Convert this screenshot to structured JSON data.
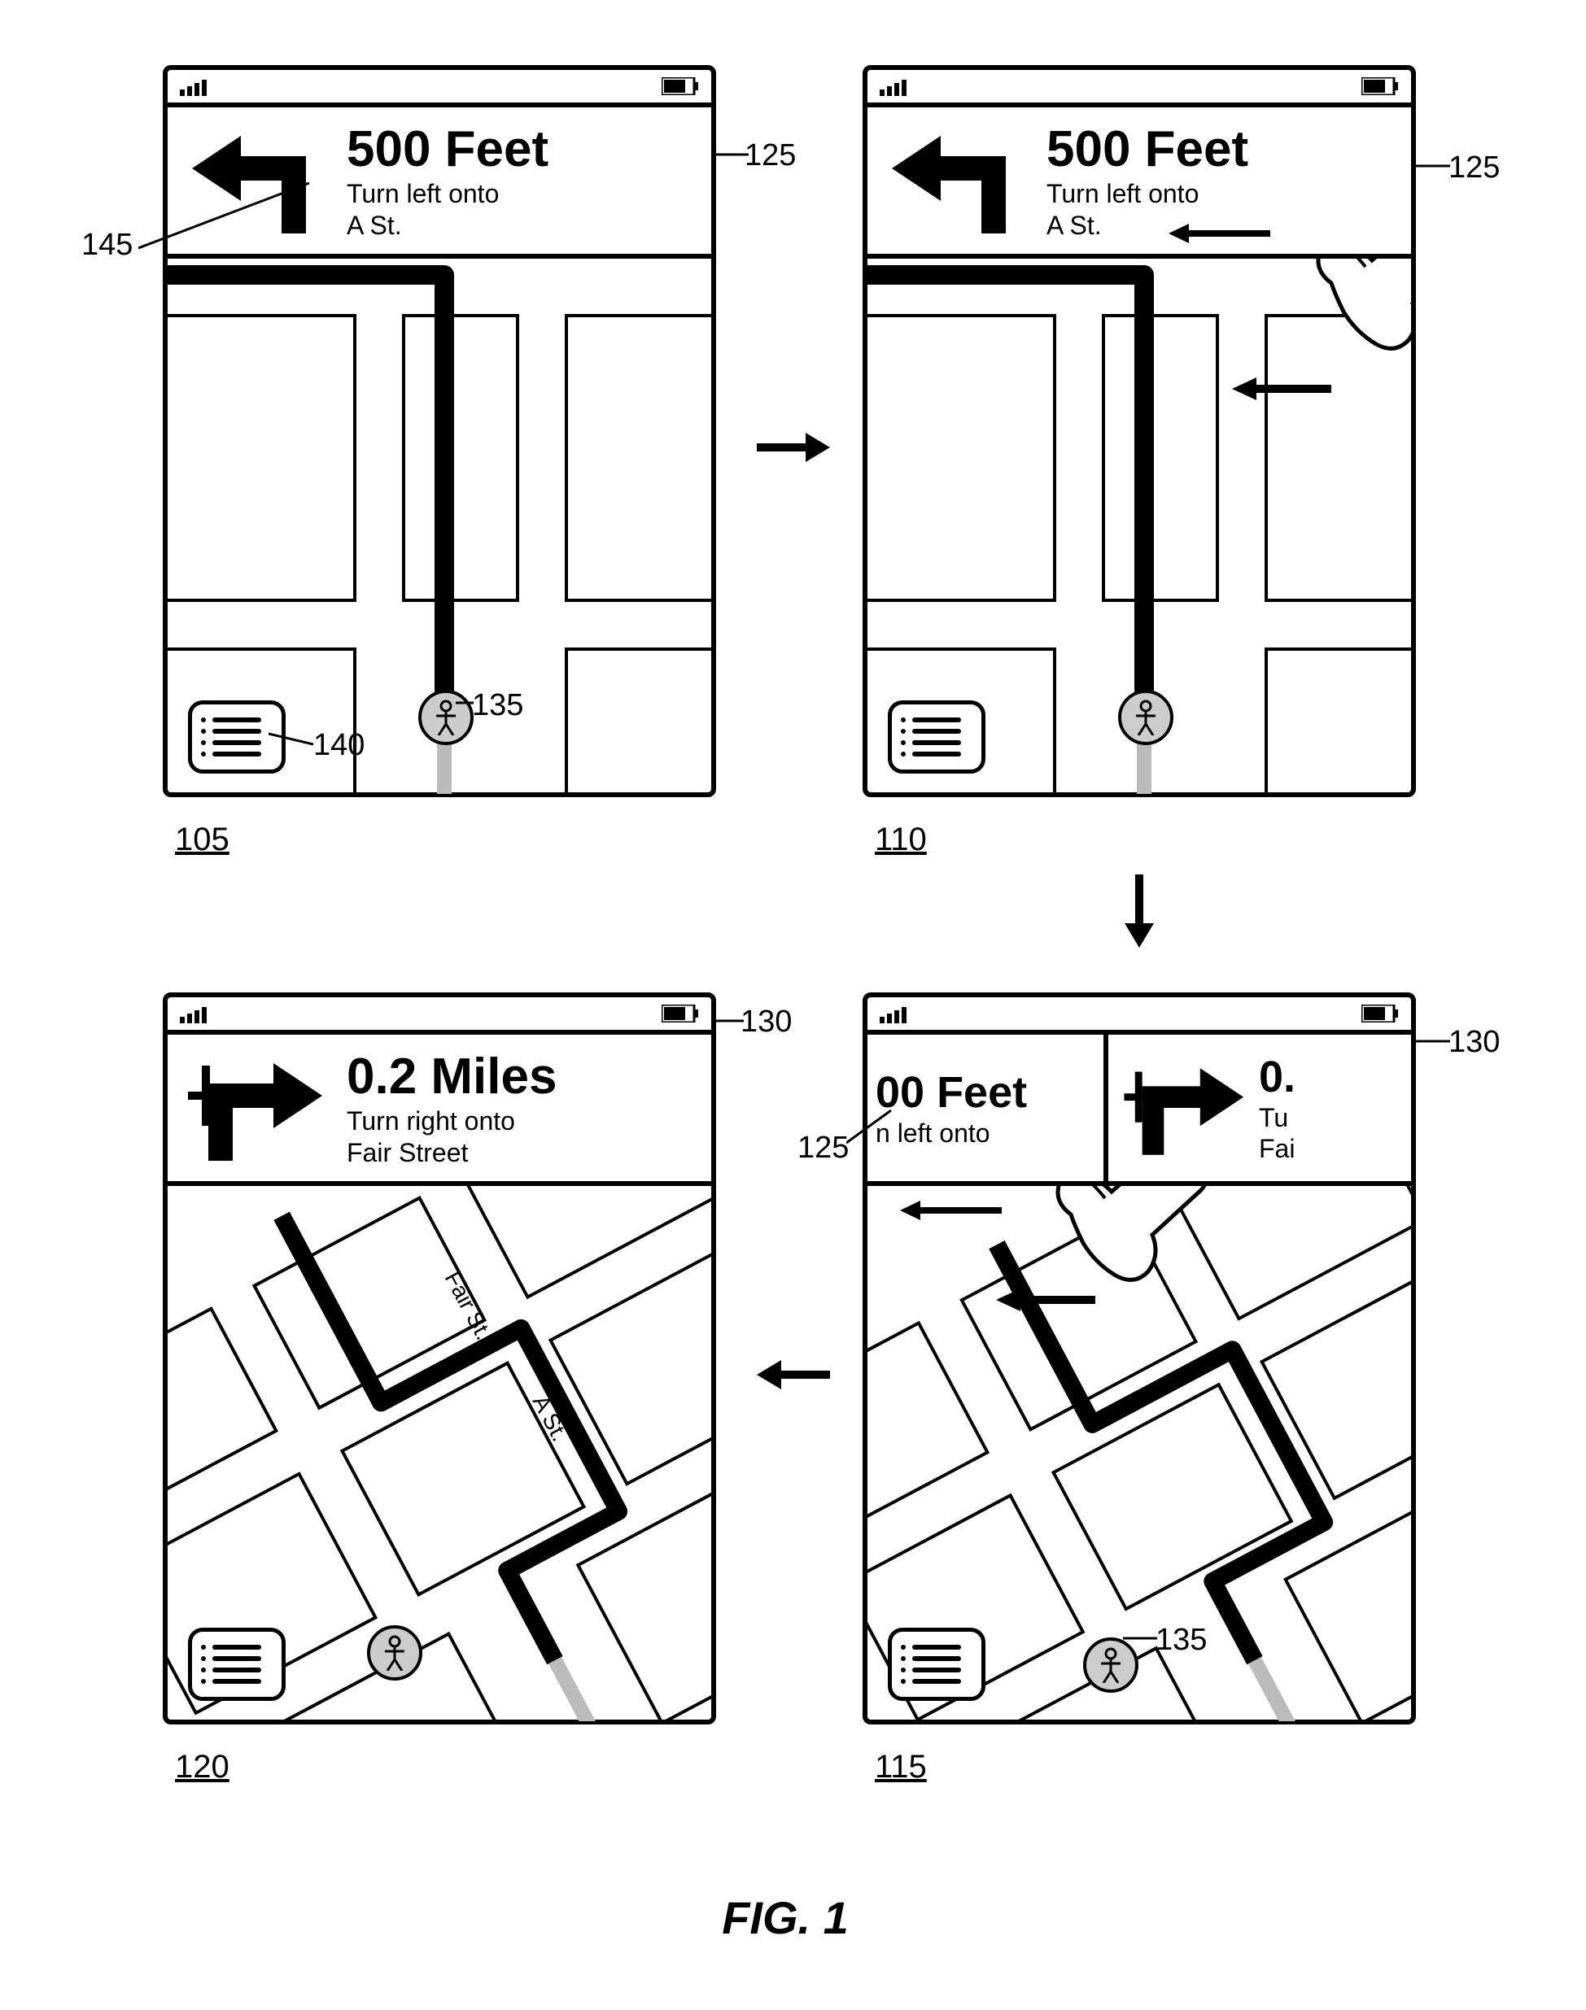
{
  "figure_label": "FIG. 1",
  "stages": {
    "s105": {
      "label": "105",
      "banner_distance": "500 Feet",
      "banner_instruction_l1": "Turn left onto",
      "banner_instruction_l2": "A St."
    },
    "s110": {
      "label": "110",
      "banner_distance": "500 Feet",
      "banner_instruction_l1": "Turn left onto",
      "banner_instruction_l2": "A St."
    },
    "s115": {
      "label": "115",
      "banner_left_distance_frag": "00 Feet",
      "banner_left_instruction_frag": "n left onto",
      "banner_right_distance_frag": "0.",
      "banner_right_instruction_frag1": "Tu",
      "banner_right_instruction_frag2": "Fai"
    },
    "s120": {
      "label": "120",
      "banner_distance": "0.2 Miles",
      "banner_instruction_l1": "Turn right onto",
      "banner_instruction_l2": "Fair Street",
      "street1": "Fair St.",
      "street2": "A St."
    }
  },
  "callouts": {
    "c125": "125",
    "c130": "130",
    "c135": "135",
    "c140": "140",
    "c145": "145"
  }
}
